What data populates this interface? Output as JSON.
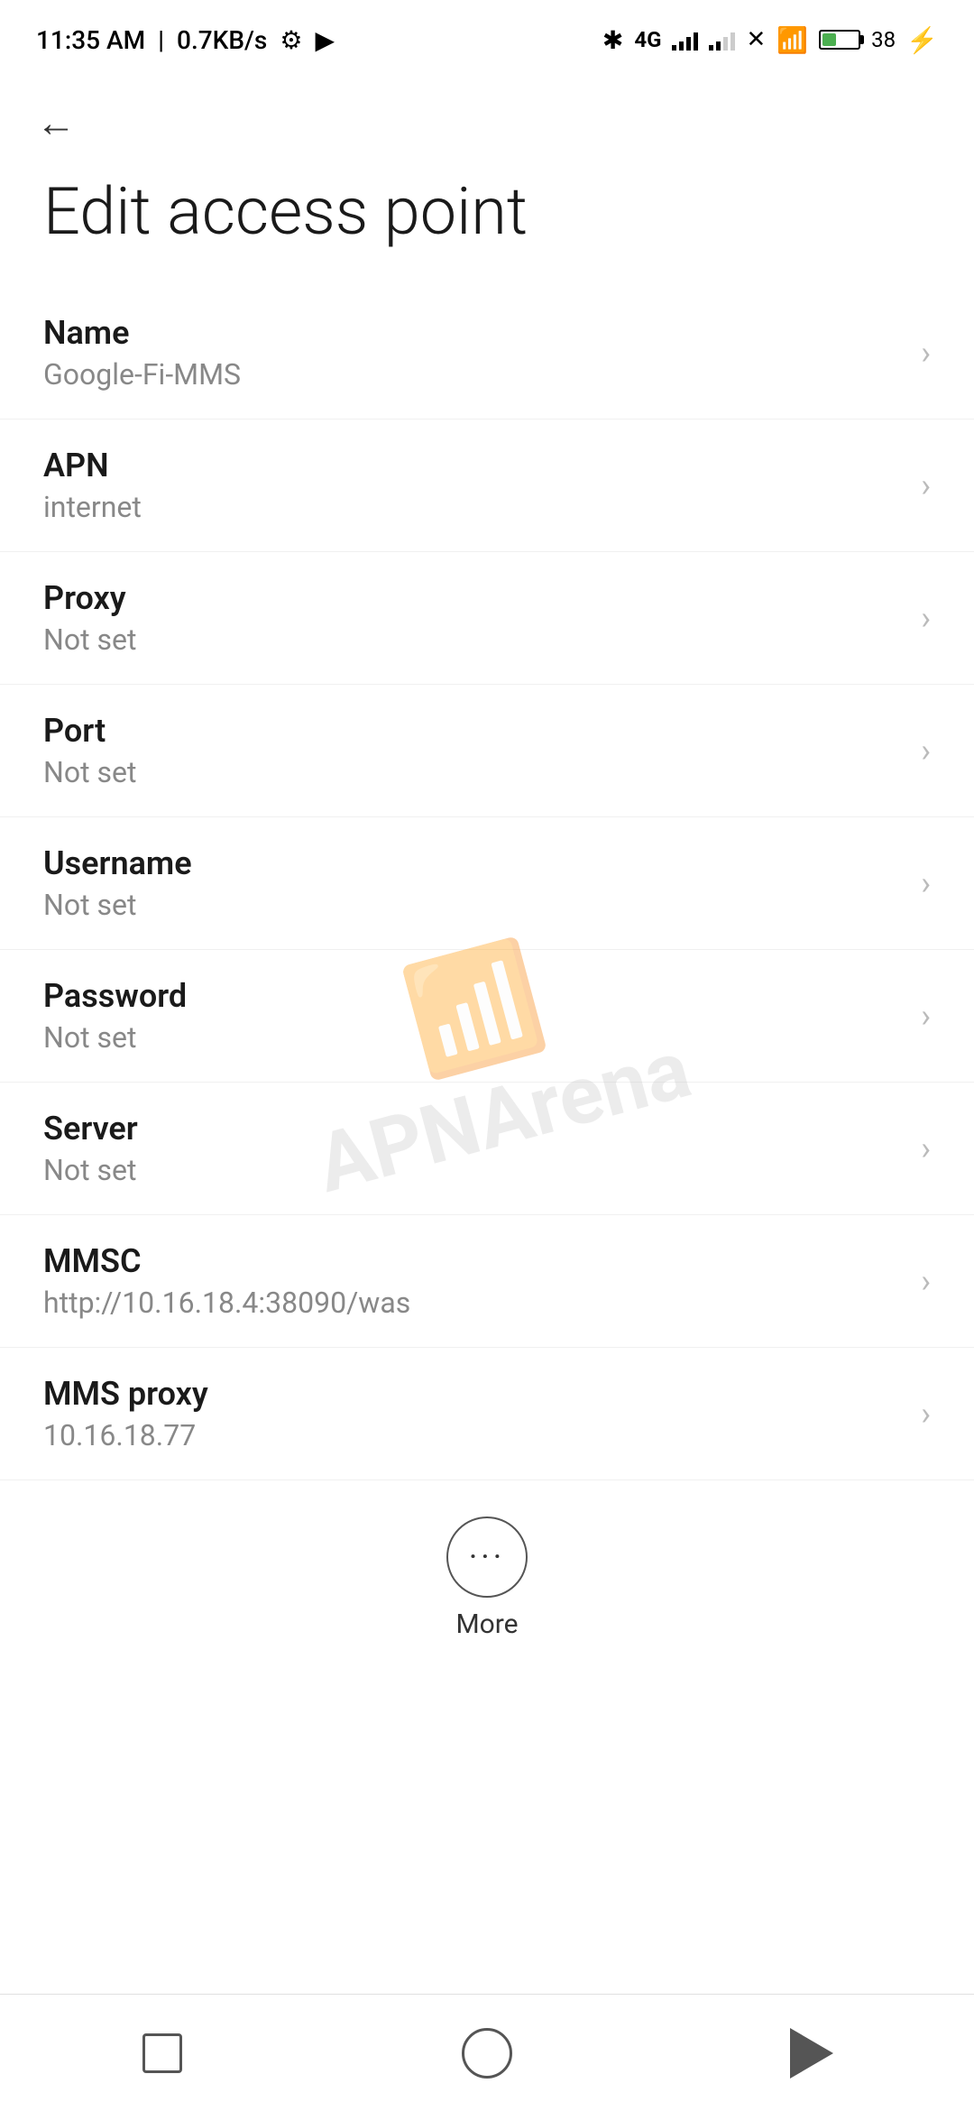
{
  "statusBar": {
    "time": "11:35 AM",
    "speed": "0.7KB/s",
    "battery": "38"
  },
  "nav": {
    "backLabel": "←"
  },
  "page": {
    "title": "Edit access point"
  },
  "settings": {
    "items": [
      {
        "label": "Name",
        "value": "Google-Fi-MMS"
      },
      {
        "label": "APN",
        "value": "internet"
      },
      {
        "label": "Proxy",
        "value": "Not set"
      },
      {
        "label": "Port",
        "value": "Not set"
      },
      {
        "label": "Username",
        "value": "Not set"
      },
      {
        "label": "Password",
        "value": "Not set"
      },
      {
        "label": "Server",
        "value": "Not set"
      },
      {
        "label": "MMSC",
        "value": "http://10.16.18.4:38090/was"
      },
      {
        "label": "MMS proxy",
        "value": "10.16.18.77"
      }
    ]
  },
  "more": {
    "label": "More"
  },
  "bottomNav": {
    "square": "square-icon",
    "circle": "home-icon",
    "back": "back-icon"
  },
  "watermark": {
    "text": "APNArena"
  }
}
